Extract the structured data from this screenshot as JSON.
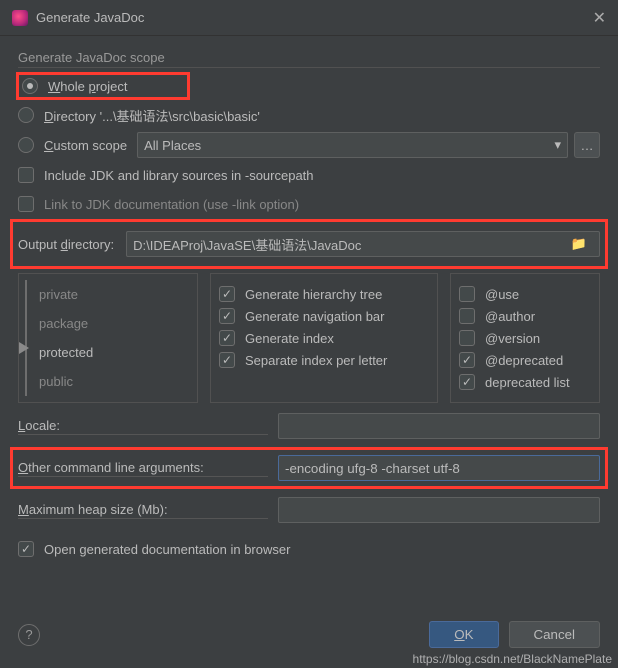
{
  "title": "Generate JavaDoc",
  "scope": {
    "label": "Generate JavaDoc scope",
    "whole_project": "Whole project",
    "directory": "Directory '...\\基础语法\\src\\basic\\basic'",
    "custom_scope": "Custom scope",
    "custom_value": "All Places"
  },
  "checks": {
    "include_jdk": "Include JDK and library sources in -sourcepath",
    "link_jdk": "Link to JDK documentation (use -link option)"
  },
  "output": {
    "label": "Output directory:",
    "value": "D:\\IDEAProj\\JavaSE\\基础语法\\JavaDoc"
  },
  "visibility": [
    "private",
    "package",
    "protected",
    "public"
  ],
  "gen_opts": {
    "hierarchy": "Generate hierarchy tree",
    "navbar": "Generate navigation bar",
    "index": "Generate index",
    "sep_index": "Separate index per letter"
  },
  "tags": {
    "use": "@use",
    "author": "@author",
    "version": "@version",
    "deprecated": "@deprecated",
    "deprecated_list": "deprecated list"
  },
  "locale": {
    "label": "Locale:",
    "value": ""
  },
  "cli": {
    "label": "Other command line arguments:",
    "value": "-encoding ufg-8 -charset utf-8"
  },
  "heap": {
    "label": "Maximum heap size (Mb):",
    "value": ""
  },
  "open_browser": "Open generated documentation in browser",
  "buttons": {
    "ok": "OK",
    "cancel": "Cancel"
  },
  "watermark": "https://blog.csdn.net/BlackNamePlate"
}
